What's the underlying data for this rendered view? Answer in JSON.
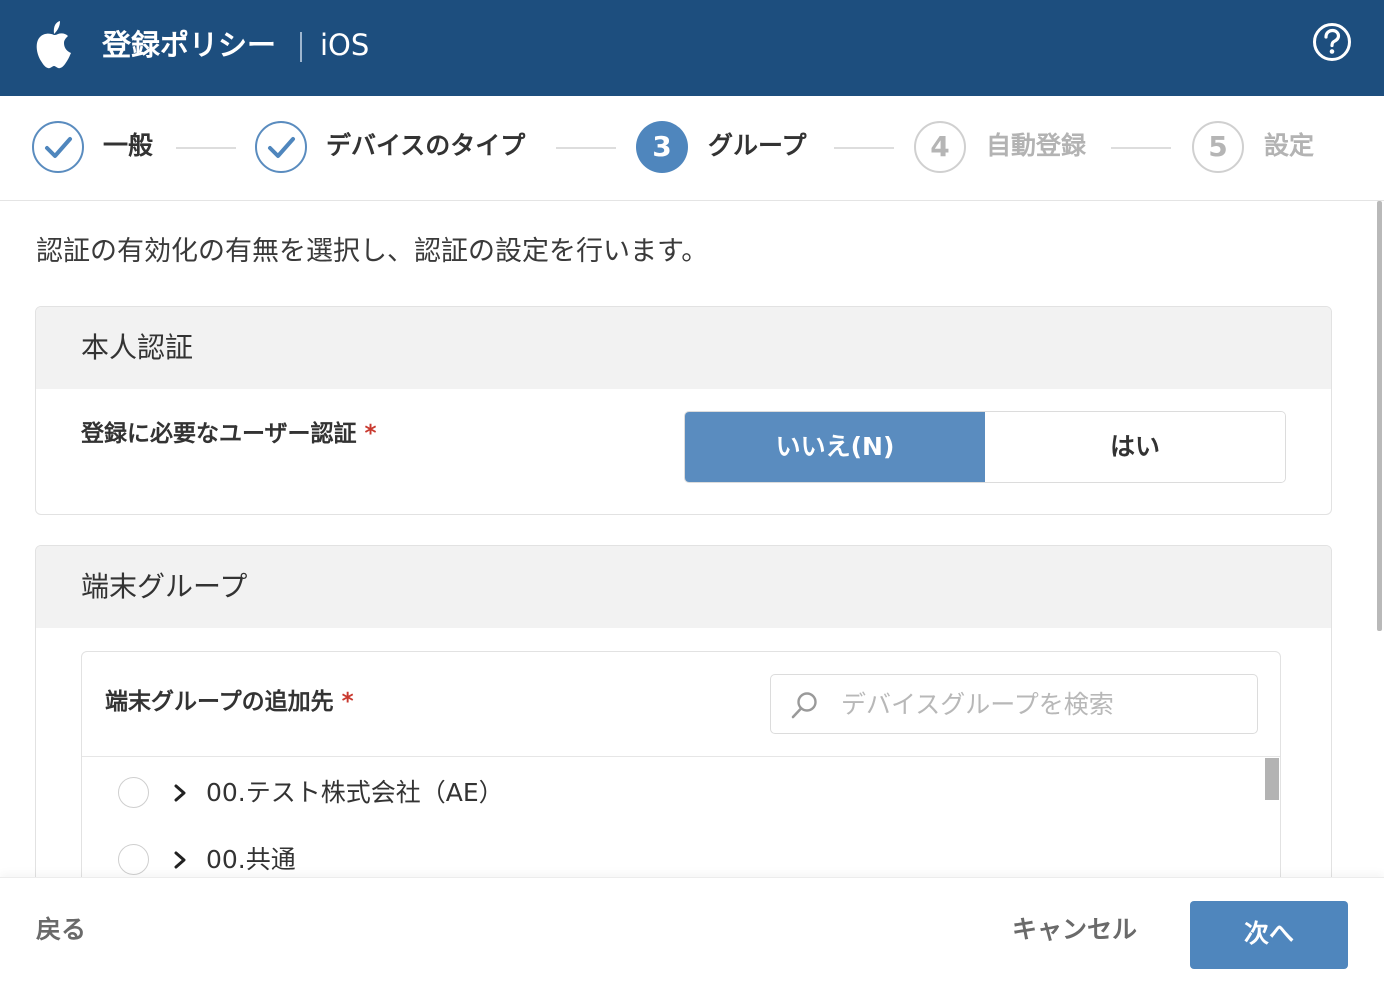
{
  "header": {
    "title": "登録ポリシー",
    "platform": "iOS",
    "logo_icon": "apple-icon",
    "help_icon": "help-icon"
  },
  "stepper": {
    "steps": [
      {
        "number": "",
        "label": "一般",
        "state": "done"
      },
      {
        "number": "",
        "label": "デバイスのタイプ",
        "state": "done"
      },
      {
        "number": "3",
        "label": "グループ",
        "state": "active"
      },
      {
        "number": "4",
        "label": "自動登録",
        "state": "todo"
      },
      {
        "number": "5",
        "label": "設定",
        "state": "todo"
      }
    ]
  },
  "intro": "認証の有効化の有無を選択し、認証の設定を行います。",
  "auth_section": {
    "title": "本人認証",
    "field_label": "登録に必要なユーザー認証",
    "required_mark": "*",
    "options": [
      "いいえ(N)",
      "はい"
    ],
    "selected": "いいえ(N)"
  },
  "group_section": {
    "title": "端末グループ",
    "field_label": "端末グループの追加先",
    "required_mark": "*",
    "search_placeholder": "デバイスグループを検索",
    "items": [
      "00.テスト株式会社（AE）",
      "00.共通"
    ]
  },
  "footer": {
    "back_label": "戻る",
    "cancel_label": "キャンセル",
    "next_label": "次へ"
  },
  "colors": {
    "header_bg": "#1d4e7e",
    "accent": "#4f86bd",
    "required": "#c9392f"
  }
}
